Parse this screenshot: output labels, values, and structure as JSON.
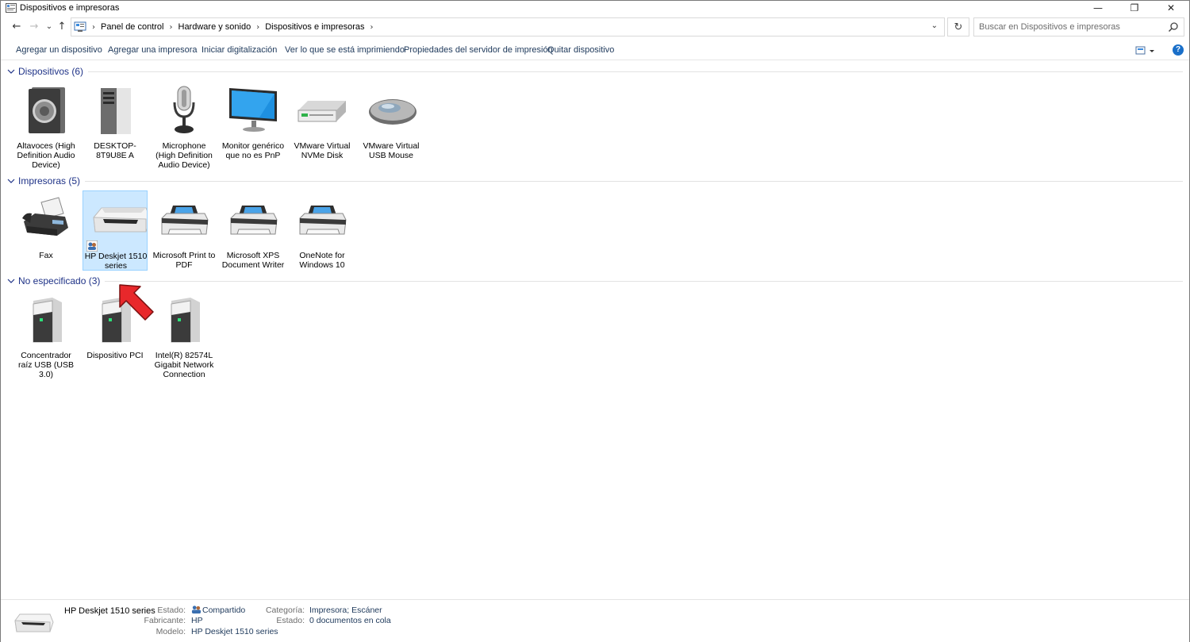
{
  "window": {
    "title": "Dispositivos e impresoras",
    "minimize": "—",
    "restore": "❐",
    "close": "✕"
  },
  "nav": {
    "back": "←",
    "forward": "→",
    "recent": "⌄",
    "up": "↑",
    "refresh": "↻",
    "breadcrumbs": [
      "Panel de control",
      "Hardware y sonido",
      "Dispositivos e impresoras"
    ],
    "search_placeholder": "Buscar en Dispositivos e impresoras"
  },
  "commands": [
    "Agregar un dispositivo",
    "Agregar una impresora",
    "Iniciar digitalización",
    "Ver lo que se está imprimiendo",
    "Propiedades del servidor de impresión",
    "Quitar dispositivo"
  ],
  "help_label": "?",
  "groups": [
    {
      "title": "Dispositivos (6)",
      "items": [
        {
          "label": "Altavoces (High Definition Audio Device)",
          "icon": "speaker-icon"
        },
        {
          "label": "DESKTOP-8T9U8E A",
          "icon": "computer-icon"
        },
        {
          "label": "Microphone (High Definition Audio Device)",
          "icon": "microphone-icon"
        },
        {
          "label": "Monitor genérico que no es PnP",
          "icon": "monitor-icon"
        },
        {
          "label": "VMware Virtual NVMe Disk",
          "icon": "disk-icon"
        },
        {
          "label": "VMware Virtual USB Mouse",
          "icon": "mouse-icon"
        }
      ]
    },
    {
      "title": "Impresoras (5)",
      "items": [
        {
          "label": "Fax",
          "icon": "fax-icon"
        },
        {
          "label": "HP Deskjet 1510 series",
          "icon": "hp-printer-icon",
          "selected": true
        },
        {
          "label": "Microsoft Print to PDF",
          "icon": "printer-icon"
        },
        {
          "label": "Microsoft XPS Document Writer",
          "icon": "printer-icon"
        },
        {
          "label": "OneNote for Windows 10",
          "icon": "printer-icon"
        }
      ]
    },
    {
      "title": "No especificado (3)",
      "items": [
        {
          "label": "Concentrador raíz USB (USB 3.0)",
          "icon": "device-tower-icon"
        },
        {
          "label": "Dispositivo PCI",
          "icon": "device-tower-icon"
        },
        {
          "label": "Intel(R) 82574L Gigabit Network Connection",
          "icon": "device-tower-icon"
        }
      ]
    }
  ],
  "details": {
    "name": "HP Deskjet 1510 series",
    "estado_label": "Estado:",
    "estado_value": "Compartido",
    "fabricante_label": "Fabricante:",
    "fabricante_value": "HP",
    "modelo_label": "Modelo:",
    "modelo_value": "HP Deskjet 1510 series",
    "categoria_label": "Categoría:",
    "categoria_value": "Impresora; Escáner",
    "estado2_label": "Estado:",
    "estado2_value": "0 documentos en cola"
  },
  "colors": {
    "link": "#1e395b",
    "group_title": "#1e3287",
    "selection_bg": "#cce8ff",
    "selection_border": "#99d1ff",
    "arrow": "#e8282b"
  }
}
